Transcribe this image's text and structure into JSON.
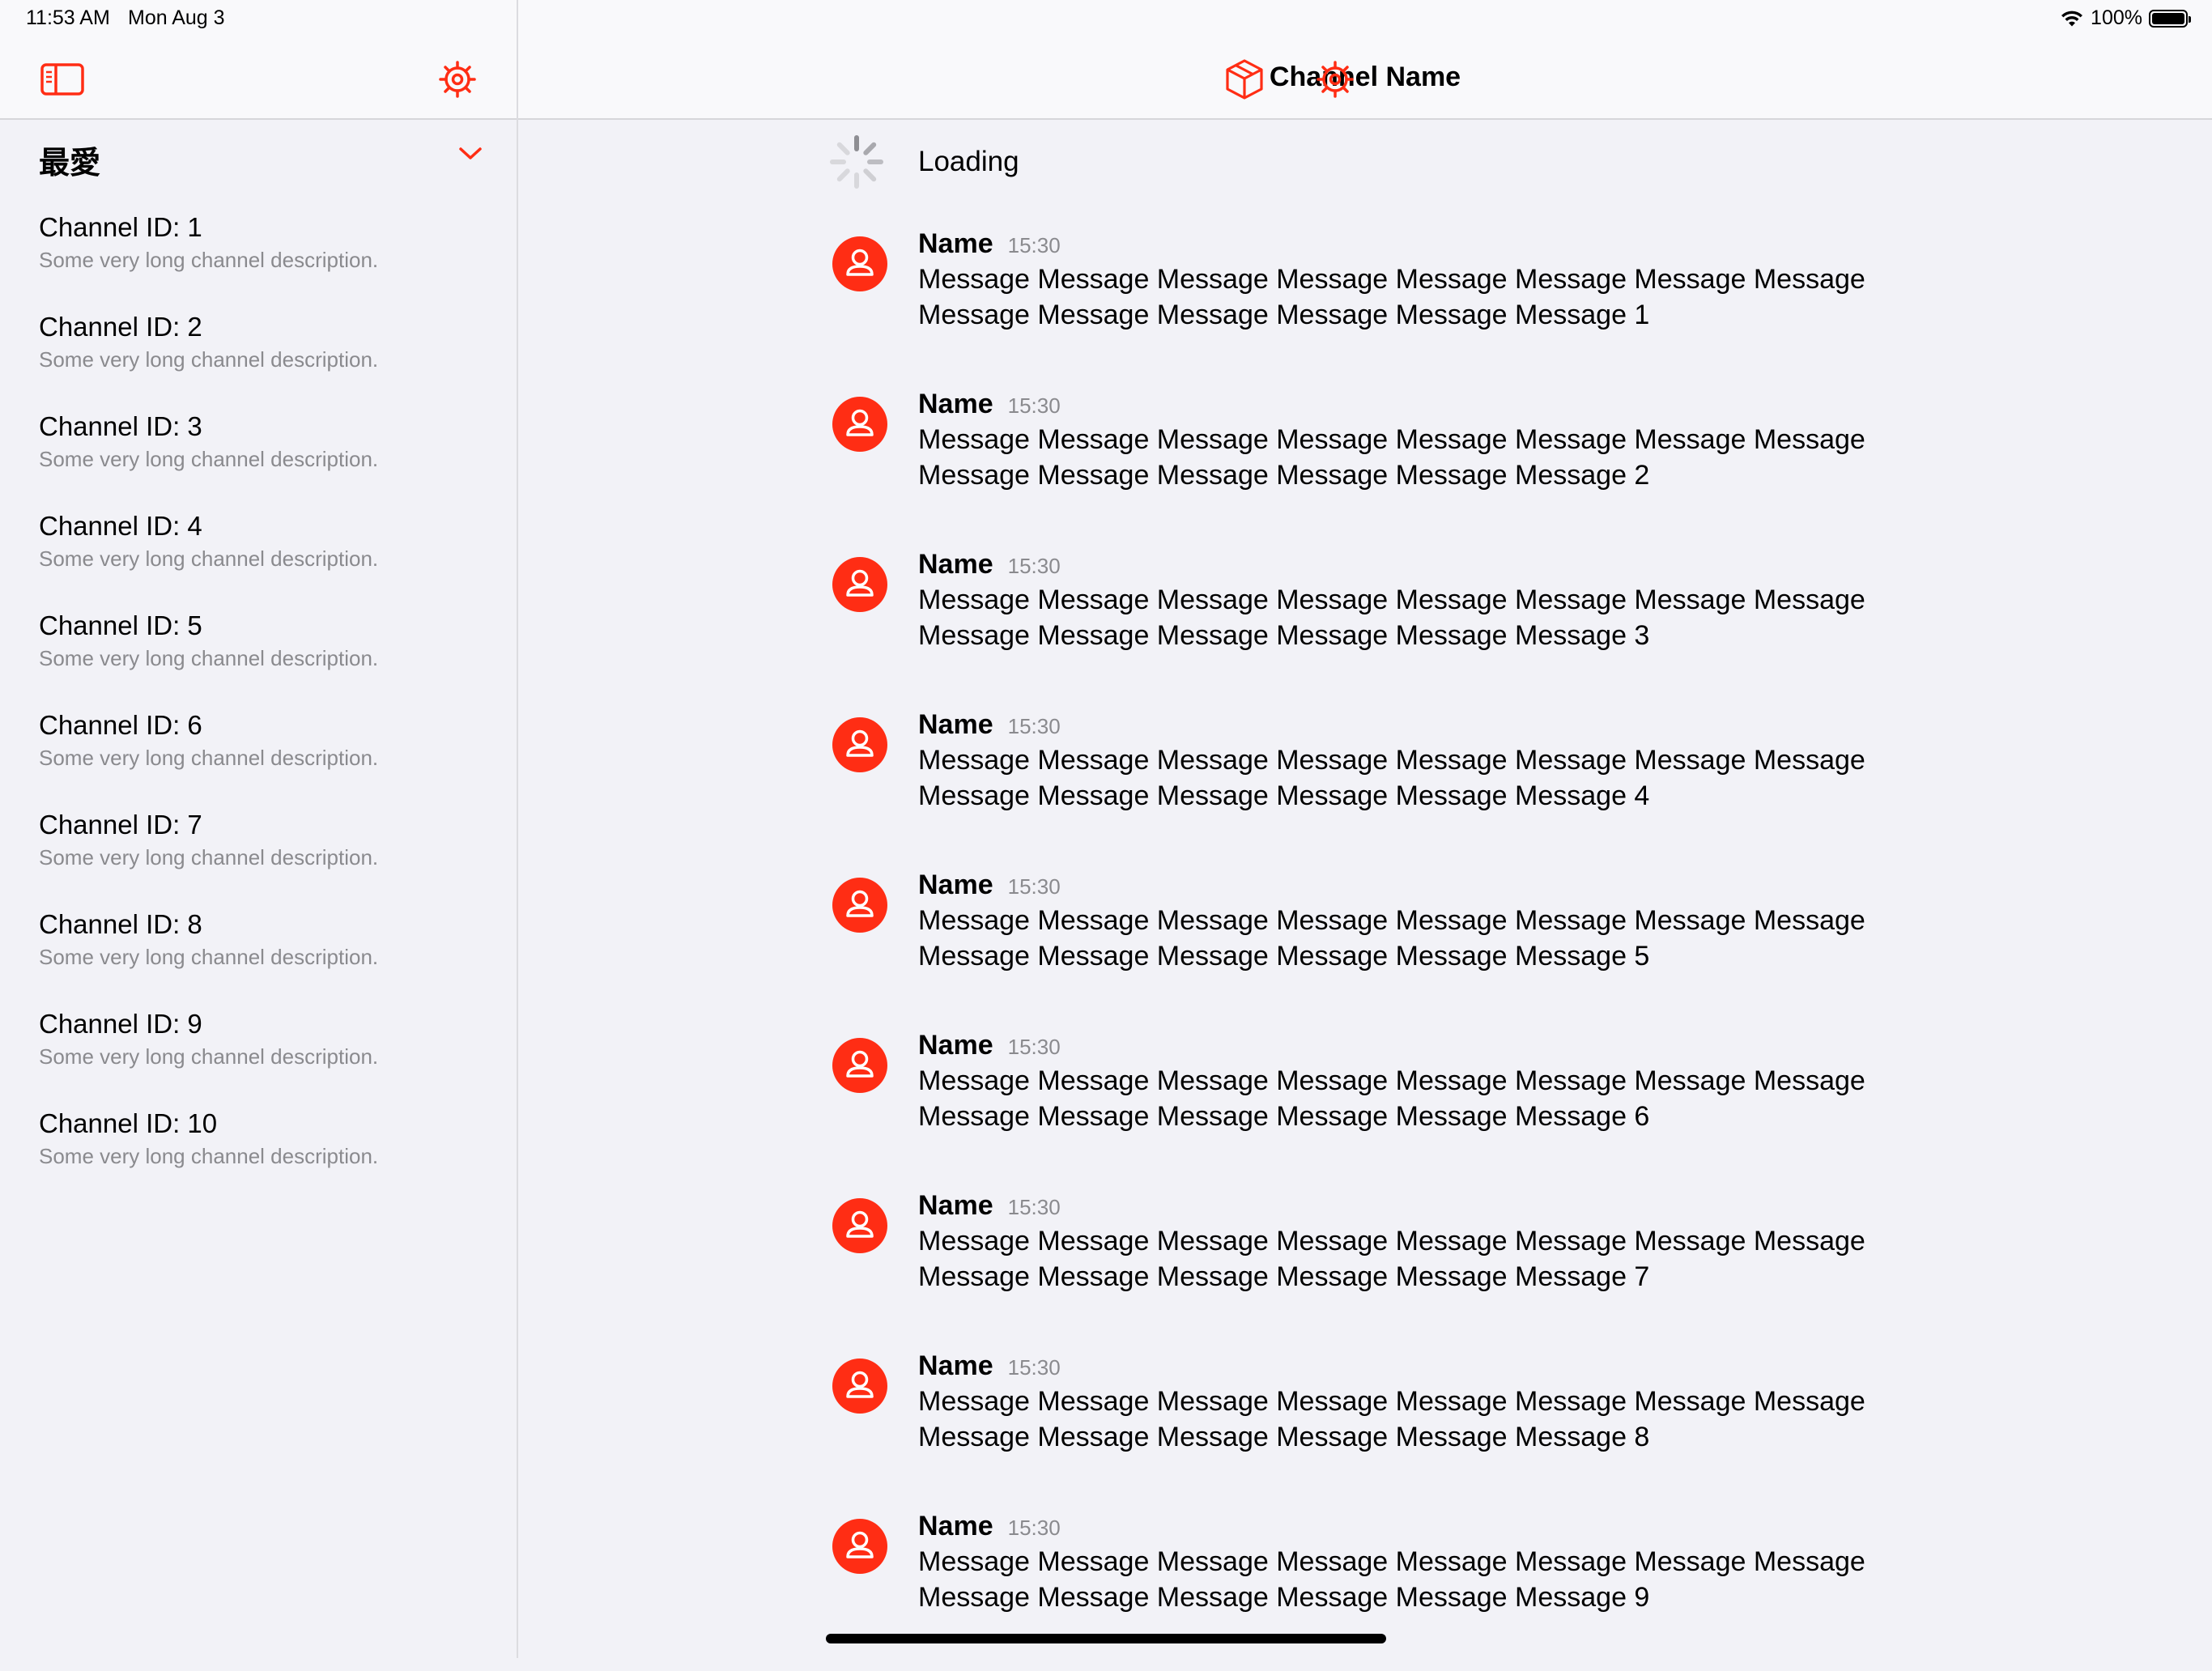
{
  "status_bar": {
    "time": "11:53 AM",
    "date": "Mon Aug 3",
    "battery": "100%"
  },
  "sidebar": {
    "section_title": "最愛",
    "channels": [
      {
        "title": "Channel ID: 1",
        "description": "Some very long channel description."
      },
      {
        "title": "Channel ID: 2",
        "description": "Some very long channel description."
      },
      {
        "title": "Channel ID: 3",
        "description": "Some very long channel description."
      },
      {
        "title": "Channel ID: 4",
        "description": "Some very long channel description."
      },
      {
        "title": "Channel ID: 5",
        "description": "Some very long channel description."
      },
      {
        "title": "Channel ID: 6",
        "description": "Some very long channel description."
      },
      {
        "title": "Channel ID: 7",
        "description": "Some very long channel description."
      },
      {
        "title": "Channel ID: 8",
        "description": "Some very long channel description."
      },
      {
        "title": "Channel ID: 9",
        "description": "Some very long channel description."
      },
      {
        "title": "Channel ID: 10",
        "description": "Some very long channel description."
      }
    ]
  },
  "main": {
    "title": "Channel Name",
    "loading_label": "Loading",
    "messages": [
      {
        "name": "Name",
        "time": "15:30",
        "text": "Message Message Message Message Message Message Message Message Message Message Message Message Message Message 1"
      },
      {
        "name": "Name",
        "time": "15:30",
        "text": "Message Message Message Message Message Message Message Message Message Message Message Message Message Message 2"
      },
      {
        "name": "Name",
        "time": "15:30",
        "text": "Message Message Message Message Message Message Message Message Message Message Message Message Message Message 3"
      },
      {
        "name": "Name",
        "time": "15:30",
        "text": "Message Message Message Message Message Message Message Message Message Message Message Message Message Message 4"
      },
      {
        "name": "Name",
        "time": "15:30",
        "text": "Message Message Message Message Message Message Message Message Message Message Message Message Message Message 5"
      },
      {
        "name": "Name",
        "time": "15:30",
        "text": "Message Message Message Message Message Message Message Message Message Message Message Message Message Message 6"
      },
      {
        "name": "Name",
        "time": "15:30",
        "text": "Message Message Message Message Message Message Message Message Message Message Message Message Message Message 7"
      },
      {
        "name": "Name",
        "time": "15:30",
        "text": "Message Message Message Message Message Message Message Message Message Message Message Message Message Message 8"
      },
      {
        "name": "Name",
        "time": "15:30",
        "text": "Message Message Message Message Message Message Message Message Message Message Message Message Message Message 9"
      }
    ]
  },
  "icons": {
    "sidebar_toggle": "sidebar-toggle-icon",
    "settings": "gear-icon",
    "section_toggle": "chevron-down-icon",
    "package": "cube-icon",
    "avatar": "person-circle-icon",
    "loading": "spinner-icon"
  },
  "colors": {
    "accent": "#ff2d14",
    "background": "#f2f2f7",
    "secondary_text": "#8a8a8e"
  }
}
